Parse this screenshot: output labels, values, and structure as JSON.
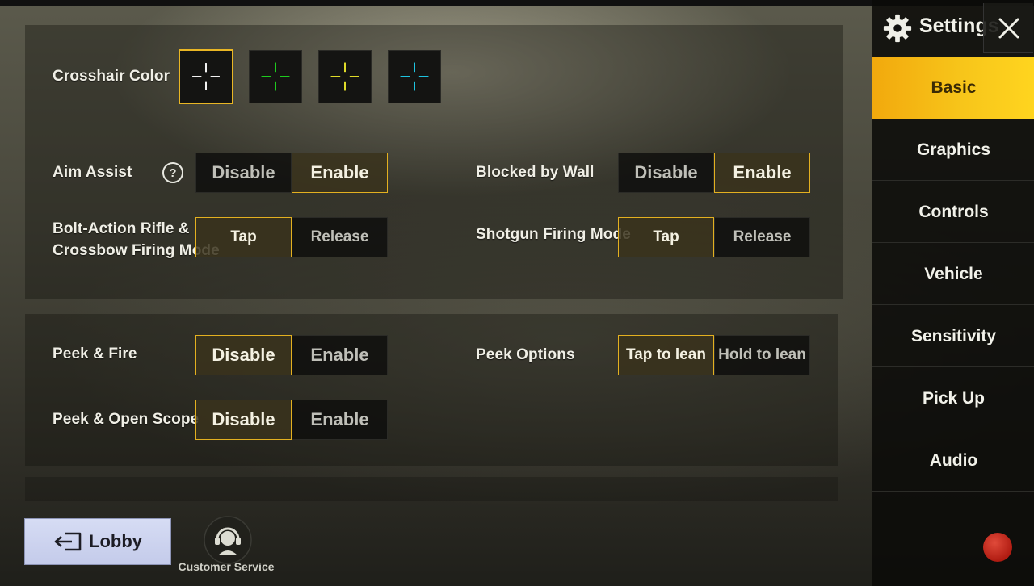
{
  "settings": {
    "crosshair": {
      "label": "Crosshair Color",
      "swatches": [
        {
          "name": "white",
          "color": "#ffffff",
          "selected": true
        },
        {
          "name": "green",
          "color": "#1ed11e",
          "selected": false
        },
        {
          "name": "yellow",
          "color": "#e6e22a",
          "selected": false
        },
        {
          "name": "cyan",
          "color": "#1fc9e6",
          "selected": false
        }
      ]
    },
    "aim_assist": {
      "label": "Aim Assist",
      "help": "?",
      "options": [
        "Disable",
        "Enable"
      ],
      "selected": "Enable"
    },
    "blocked_by_wall": {
      "label": "Blocked by Wall",
      "options": [
        "Disable",
        "Enable"
      ],
      "selected": "Enable"
    },
    "bolt_action": {
      "label_line1": "Bolt-Action Rifle &",
      "label_line2": "Crossbow Firing Mode",
      "options": [
        "Tap",
        "Release"
      ],
      "selected": "Tap"
    },
    "shotgun": {
      "label": "Shotgun Firing Mode",
      "options": [
        "Tap",
        "Release"
      ],
      "selected": "Tap"
    },
    "peek_fire": {
      "label": "Peek & Fire",
      "options": [
        "Disable",
        "Enable"
      ],
      "selected": "Disable"
    },
    "peek_options": {
      "label": "Peek Options",
      "options": [
        "Tap to lean",
        "Hold to lean"
      ],
      "selected": "Tap to lean"
    },
    "peek_scope": {
      "label": "Peek & Open Scope",
      "options": [
        "Disable",
        "Enable"
      ],
      "selected": "Disable"
    }
  },
  "sidebar": {
    "title": "Settings",
    "items": [
      {
        "label": "Basic",
        "active": true
      },
      {
        "label": "Graphics",
        "active": false
      },
      {
        "label": "Controls",
        "active": false
      },
      {
        "label": "Vehicle",
        "active": false
      },
      {
        "label": "Sensitivity",
        "active": false
      },
      {
        "label": "Pick Up",
        "active": false
      },
      {
        "label": "Audio",
        "active": false
      }
    ]
  },
  "bottom": {
    "lobby_label": "Lobby",
    "customer_service_label": "Customer Service"
  },
  "colors": {
    "accent": "#e9b624",
    "nav_active": "#f7c51a",
    "record": "#c4261a"
  },
  "icons": {
    "gear": "gear-icon",
    "close": "close-icon",
    "help": "help-icon",
    "lobby": "exit-icon",
    "customer_service": "headset-icon",
    "crosshair": "crosshair-icon"
  }
}
